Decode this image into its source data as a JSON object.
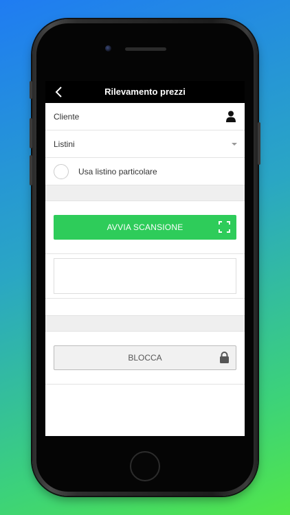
{
  "header": {
    "title": "Rilevamento prezzi",
    "back_icon": "chevron-left-icon"
  },
  "form": {
    "cliente_label": "Cliente",
    "cliente_icon": "user-icon",
    "listini_label": "Listini",
    "listini_icon": "caret-down-icon",
    "usa_listino_label": "Usa listino particolare",
    "usa_listino_checked": false
  },
  "scan": {
    "label": "AVVIA SCANSIONE",
    "icon": "scan-frame-icon",
    "color": "#2ecc5a"
  },
  "result": {
    "value": ""
  },
  "block": {
    "label": "BLOCCA",
    "icon": "lock-icon"
  }
}
